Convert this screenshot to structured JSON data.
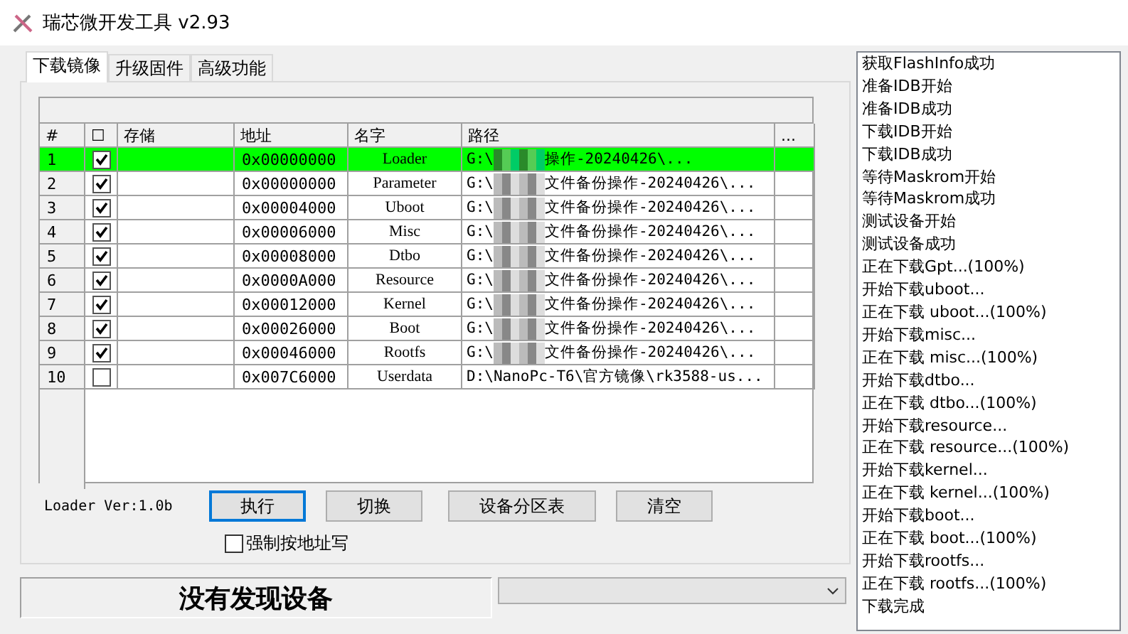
{
  "window": {
    "title": "瑞芯微开发工具 v2.93"
  },
  "tabs": [
    {
      "label": "下载镜像",
      "selected": true
    },
    {
      "label": "升级固件",
      "selected": false
    },
    {
      "label": "高级功能",
      "selected": false
    }
  ],
  "table": {
    "columns": [
      "#",
      "☐",
      "存储",
      "地址",
      "名字",
      "路径",
      "..."
    ],
    "rows": [
      {
        "index": "1",
        "checked": true,
        "selected": true,
        "address": "0x00000000",
        "name": "Loader",
        "path_start": "G:\\",
        "redacted": true,
        "path_end": "操作-20240426\\..."
      },
      {
        "index": "2",
        "checked": true,
        "selected": false,
        "address": "0x00000000",
        "name": "Parameter",
        "path_start": "G:\\",
        "redacted": true,
        "path_end": "文件备份操作-20240426\\..."
      },
      {
        "index": "3",
        "checked": true,
        "selected": false,
        "address": "0x00004000",
        "name": "Uboot",
        "path_start": "G:\\",
        "redacted": true,
        "path_end": "文件备份操作-20240426\\..."
      },
      {
        "index": "4",
        "checked": true,
        "selected": false,
        "address": "0x00006000",
        "name": "Misc",
        "path_start": "G:\\",
        "redacted": true,
        "path_end": "文件备份操作-20240426\\..."
      },
      {
        "index": "5",
        "checked": true,
        "selected": false,
        "address": "0x00008000",
        "name": "Dtbo",
        "path_start": "G:\\",
        "redacted": true,
        "path_end": "文件备份操作-20240426\\..."
      },
      {
        "index": "6",
        "checked": true,
        "selected": false,
        "address": "0x0000A000",
        "name": "Resource",
        "path_start": "G:\\",
        "redacted": true,
        "path_end": "文件备份操作-20240426\\..."
      },
      {
        "index": "7",
        "checked": true,
        "selected": false,
        "address": "0x00012000",
        "name": "Kernel",
        "path_start": "G:\\",
        "redacted": true,
        "path_end": "文件备份操作-20240426\\..."
      },
      {
        "index": "8",
        "checked": true,
        "selected": false,
        "address": "0x00026000",
        "name": "Boot",
        "path_start": "G:\\",
        "redacted": true,
        "path_end": "文件备份操作-20240426\\..."
      },
      {
        "index": "9",
        "checked": true,
        "selected": false,
        "address": "0x00046000",
        "name": "Rootfs",
        "path_start": "G:\\",
        "redacted": true,
        "path_end": "文件备份操作-20240426\\..."
      },
      {
        "index": "10",
        "checked": false,
        "selected": false,
        "address": "0x007C6000",
        "name": "Userdata",
        "path_start": "D:\\NanoPc-T6\\官方镜像\\rk3588-us...",
        "redacted": false,
        "path_end": ""
      }
    ]
  },
  "loader_version": "Loader Ver:1.0b",
  "buttons": [
    {
      "label": "执行",
      "focused": true
    },
    {
      "label": "切换",
      "focused": false
    },
    {
      "label": "设备分区表",
      "focused": false
    },
    {
      "label": "清空",
      "focused": false
    }
  ],
  "force_address_write": {
    "label": "强制按地址写",
    "checked": false
  },
  "status": "没有发现设备",
  "log": [
    "获取FlashInfo成功",
    "准备IDB开始",
    "准备IDB成功",
    "下载IDB开始",
    "下载IDB成功",
    "等待Maskrom开始",
    "等待Maskrom成功",
    "测试设备开始",
    "测试设备成功",
    "正在下载Gpt...(100%)",
    "开始下载uboot...",
    "正在下载 uboot...(100%)",
    "开始下载misc...",
    "正在下载 misc...(100%)",
    "开始下载dtbo...",
    "正在下载 dtbo...(100%)",
    "开始下载resource...",
    "正在下载 resource...(100%)",
    "开始下载kernel...",
    "正在下载 kernel...(100%)",
    "开始下载boot...",
    "正在下载 boot...(100%)",
    "开始下载rootfs...",
    "正在下载 rootfs...(100%)",
    "下载完成"
  ]
}
